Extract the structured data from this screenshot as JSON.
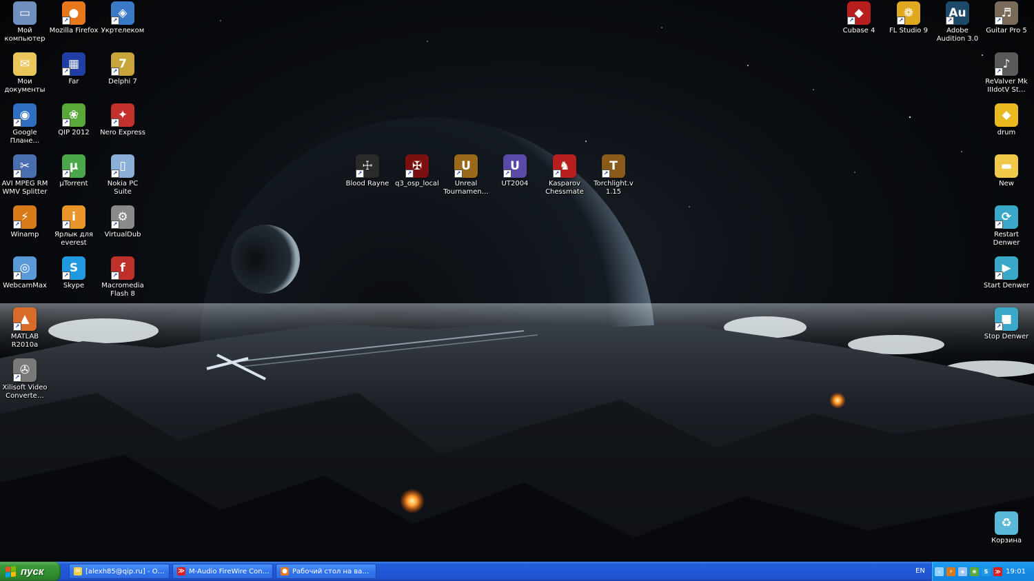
{
  "desktop": {
    "icons_left": [
      {
        "label": "Мой компьютер",
        "icon": "computer-icon",
        "bg": "#6f8fbf",
        "glyph": "▭",
        "shortcut": false
      },
      {
        "label": "Mozilla Firefox",
        "icon": "firefox-icon",
        "bg": "#e8761a",
        "glyph": "●",
        "shortcut": true
      },
      {
        "label": "Укртелеком",
        "icon": "network-icon",
        "bg": "#3a79c6",
        "glyph": "◈",
        "shortcut": true
      },
      {
        "label": "Мои документы",
        "icon": "documents-folder-icon",
        "bg": "#e8c65a",
        "glyph": "✉",
        "shortcut": false
      },
      {
        "label": "Far",
        "icon": "far-manager-icon",
        "bg": "#1f3fa6",
        "glyph": "▦",
        "shortcut": true
      },
      {
        "label": "Delphi 7",
        "icon": "delphi-icon",
        "bg": "#c8a53a",
        "glyph": "7",
        "shortcut": true
      },
      {
        "label": "Google Плане…",
        "icon": "google-earth-icon",
        "bg": "#2e6fc2",
        "glyph": "◉",
        "shortcut": true
      },
      {
        "label": "QIP 2012",
        "icon": "qip-icon",
        "bg": "#5aa83a",
        "glyph": "❀",
        "shortcut": true
      },
      {
        "label": "Nero Express",
        "icon": "nero-icon",
        "bg": "#c4302b",
        "glyph": "✦",
        "shortcut": true
      },
      {
        "label": "AVI MPEG RM WMV Splitter",
        "icon": "video-splitter-icon",
        "bg": "#4a6fb0",
        "glyph": "✂",
        "shortcut": true
      },
      {
        "label": "µTorrent",
        "icon": "utorrent-icon",
        "bg": "#4aa84a",
        "glyph": "µ",
        "shortcut": true
      },
      {
        "label": "Nokia PC Suite",
        "icon": "nokia-icon",
        "bg": "#8bb0d8",
        "glyph": "▯",
        "shortcut": true
      },
      {
        "label": "Winamp",
        "icon": "winamp-icon",
        "bg": "#d87a1a",
        "glyph": "⚡",
        "shortcut": true
      },
      {
        "label": "Ярлык для everest",
        "icon": "everest-icon",
        "bg": "#e8962a",
        "glyph": "i",
        "shortcut": true
      },
      {
        "label": "VirtualDub",
        "icon": "virtualdub-icon",
        "bg": "#8a8a8a",
        "glyph": "⚙",
        "shortcut": true
      },
      {
        "label": "WebcamMax",
        "icon": "webcam-icon",
        "bg": "#5a9ad8",
        "glyph": "◎",
        "shortcut": true
      },
      {
        "label": "Skype",
        "icon": "skype-icon",
        "bg": "#1f9ae0",
        "glyph": "S",
        "shortcut": true
      },
      {
        "label": "Macromedia Flash 8",
        "icon": "flash-icon",
        "bg": "#c0302a",
        "glyph": "f",
        "shortcut": true
      },
      {
        "label": "MATLAB R2010a",
        "icon": "matlab-icon",
        "bg": "#d86a2a",
        "glyph": "▲",
        "shortcut": true
      },
      {
        "label": "Xilisoft Video Converte…",
        "icon": "film-reel-icon",
        "bg": "#7a7a7a",
        "glyph": "✇",
        "shortcut": true
      }
    ],
    "icons_center": [
      {
        "label": "Blood Rayne",
        "icon": "bloodrayne-icon",
        "bg": "#2a2a2a",
        "glyph": "☩",
        "shortcut": true
      },
      {
        "label": "q3_osp_local",
        "icon": "quake3-icon",
        "bg": "#7a1010",
        "glyph": "✠",
        "shortcut": true
      },
      {
        "label": "Unreal Tournamen…",
        "icon": "unreal-tournament-icon",
        "bg": "#9a6a1a",
        "glyph": "U",
        "shortcut": true
      },
      {
        "label": "UT2004",
        "icon": "ut2004-icon",
        "bg": "#5a4aa8",
        "glyph": "U",
        "shortcut": true
      },
      {
        "label": "Kasparov Chessmate",
        "icon": "chess-icon",
        "bg": "#b81e1e",
        "glyph": "♞",
        "shortcut": true
      },
      {
        "label": "Torchlight.v 1.15",
        "icon": "torchlight-icon",
        "bg": "#8a5a1a",
        "glyph": "T",
        "shortcut": true
      }
    ],
    "icons_right": [
      {
        "label": "Cubase 4",
        "icon": "cubase-icon",
        "bg": "#b81e1e",
        "glyph": "◆",
        "shortcut": true
      },
      {
        "label": "FL Studio 9",
        "icon": "fl-studio-icon",
        "bg": "#e0a81e",
        "glyph": "❁",
        "shortcut": true
      },
      {
        "label": "Adobe Audition 3.0",
        "icon": "audition-icon",
        "bg": "#1e4a6a",
        "glyph": "Au",
        "shortcut": true
      },
      {
        "label": "Guitar Pro 5",
        "icon": "guitar-pro-icon",
        "bg": "#7a6a5a",
        "glyph": "♬",
        "shortcut": true
      },
      {
        "label": "ReValver Mk IIIdotV St…",
        "icon": "guitar-icon",
        "bg": "#5a5a5a",
        "glyph": "♪",
        "shortcut": true
      },
      {
        "label": "drum",
        "icon": "cube-icon",
        "bg": "#e8b81e",
        "glyph": "◆",
        "shortcut": false
      },
      {
        "label": "New",
        "icon": "folder-icon",
        "bg": "#f0c84a",
        "glyph": "▬",
        "shortcut": false
      },
      {
        "label": "Restart Denwer",
        "icon": "denwer-restart-icon",
        "bg": "#3aa8c8",
        "glyph": "⟳",
        "shortcut": true
      },
      {
        "label": "Start Denwer",
        "icon": "denwer-start-icon",
        "bg": "#3aa8c8",
        "glyph": "▶",
        "shortcut": true
      },
      {
        "label": "Stop Denwer",
        "icon": "denwer-stop-icon",
        "bg": "#3aa8c8",
        "glyph": "■",
        "shortcut": true
      },
      {
        "label": "Корзина",
        "icon": "recycle-bin-icon",
        "bg": "#5ab8d8",
        "glyph": "♻",
        "shortcut": false
      }
    ]
  },
  "taskbar": {
    "start_label": "пуск",
    "tasks": [
      {
        "label": "[alexh85@qip.ru] - O…",
        "icon": "mail-icon",
        "color": "#f0d040",
        "glyph": "✉"
      },
      {
        "label": "M-Audio FireWire Con…",
        "icon": "m-audio-icon",
        "color": "#d82020",
        "glyph": "≫"
      },
      {
        "label": "Рабочий стол на ва…",
        "icon": "firefox-icon",
        "color": "#e8761a",
        "glyph": "●"
      }
    ],
    "tray": {
      "language": "EN",
      "icons": [
        {
          "name": "arrow-left-icon",
          "color": "#8fd0ff",
          "glyph": "‹"
        },
        {
          "name": "winamp-tray-icon",
          "color": "#d87a1a",
          "glyph": "⚡"
        },
        {
          "name": "network-tray-icon",
          "color": "#9ec4f0",
          "glyph": "◈"
        },
        {
          "name": "qip-tray-icon",
          "color": "#5aa83a",
          "glyph": "❀"
        },
        {
          "name": "skype-tray-icon",
          "color": "#1f9ae0",
          "glyph": "S"
        },
        {
          "name": "m-audio-tray-icon",
          "color": "#d82020",
          "glyph": "≫"
        }
      ],
      "clock": "19:01"
    }
  }
}
